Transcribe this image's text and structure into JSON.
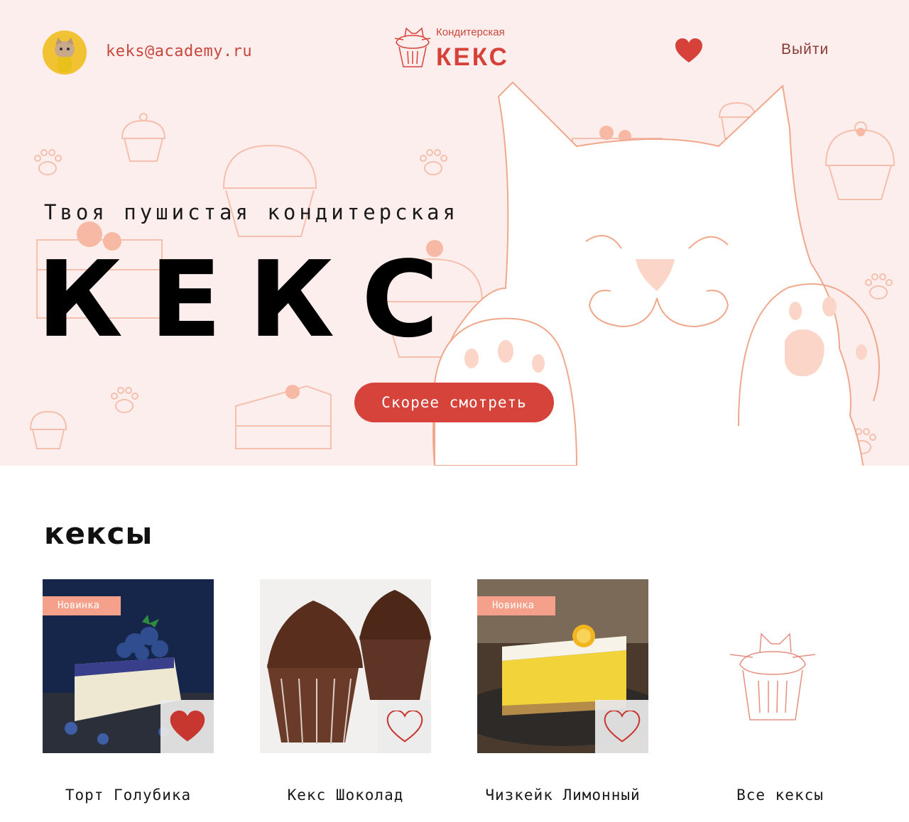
{
  "header": {
    "user_email": "keks@academy.ru",
    "logo_small": "Кондитерская",
    "logo_big": "КЕКС",
    "logout_label": "Выйти",
    "favorites_icon": "heart-icon"
  },
  "hero": {
    "subtitle": "Твоя пушистая кондитерская",
    "title": "КЕКС",
    "cta_label": "Скорее смотреть"
  },
  "catalog": {
    "title": "кексы",
    "cards": [
      {
        "name": "Торт Голубика",
        "badge": "Новинка",
        "liked": true
      },
      {
        "name": "Кекс Шоколад",
        "badge": "",
        "liked": false
      },
      {
        "name": "Чизкейк Лимонный",
        "badge": "Новинка",
        "liked": false
      }
    ],
    "all_label": "Все кексы"
  },
  "colors": {
    "accent": "#d5433a",
    "hero_bg": "#fdeeee",
    "badge": "#f4a08a"
  }
}
